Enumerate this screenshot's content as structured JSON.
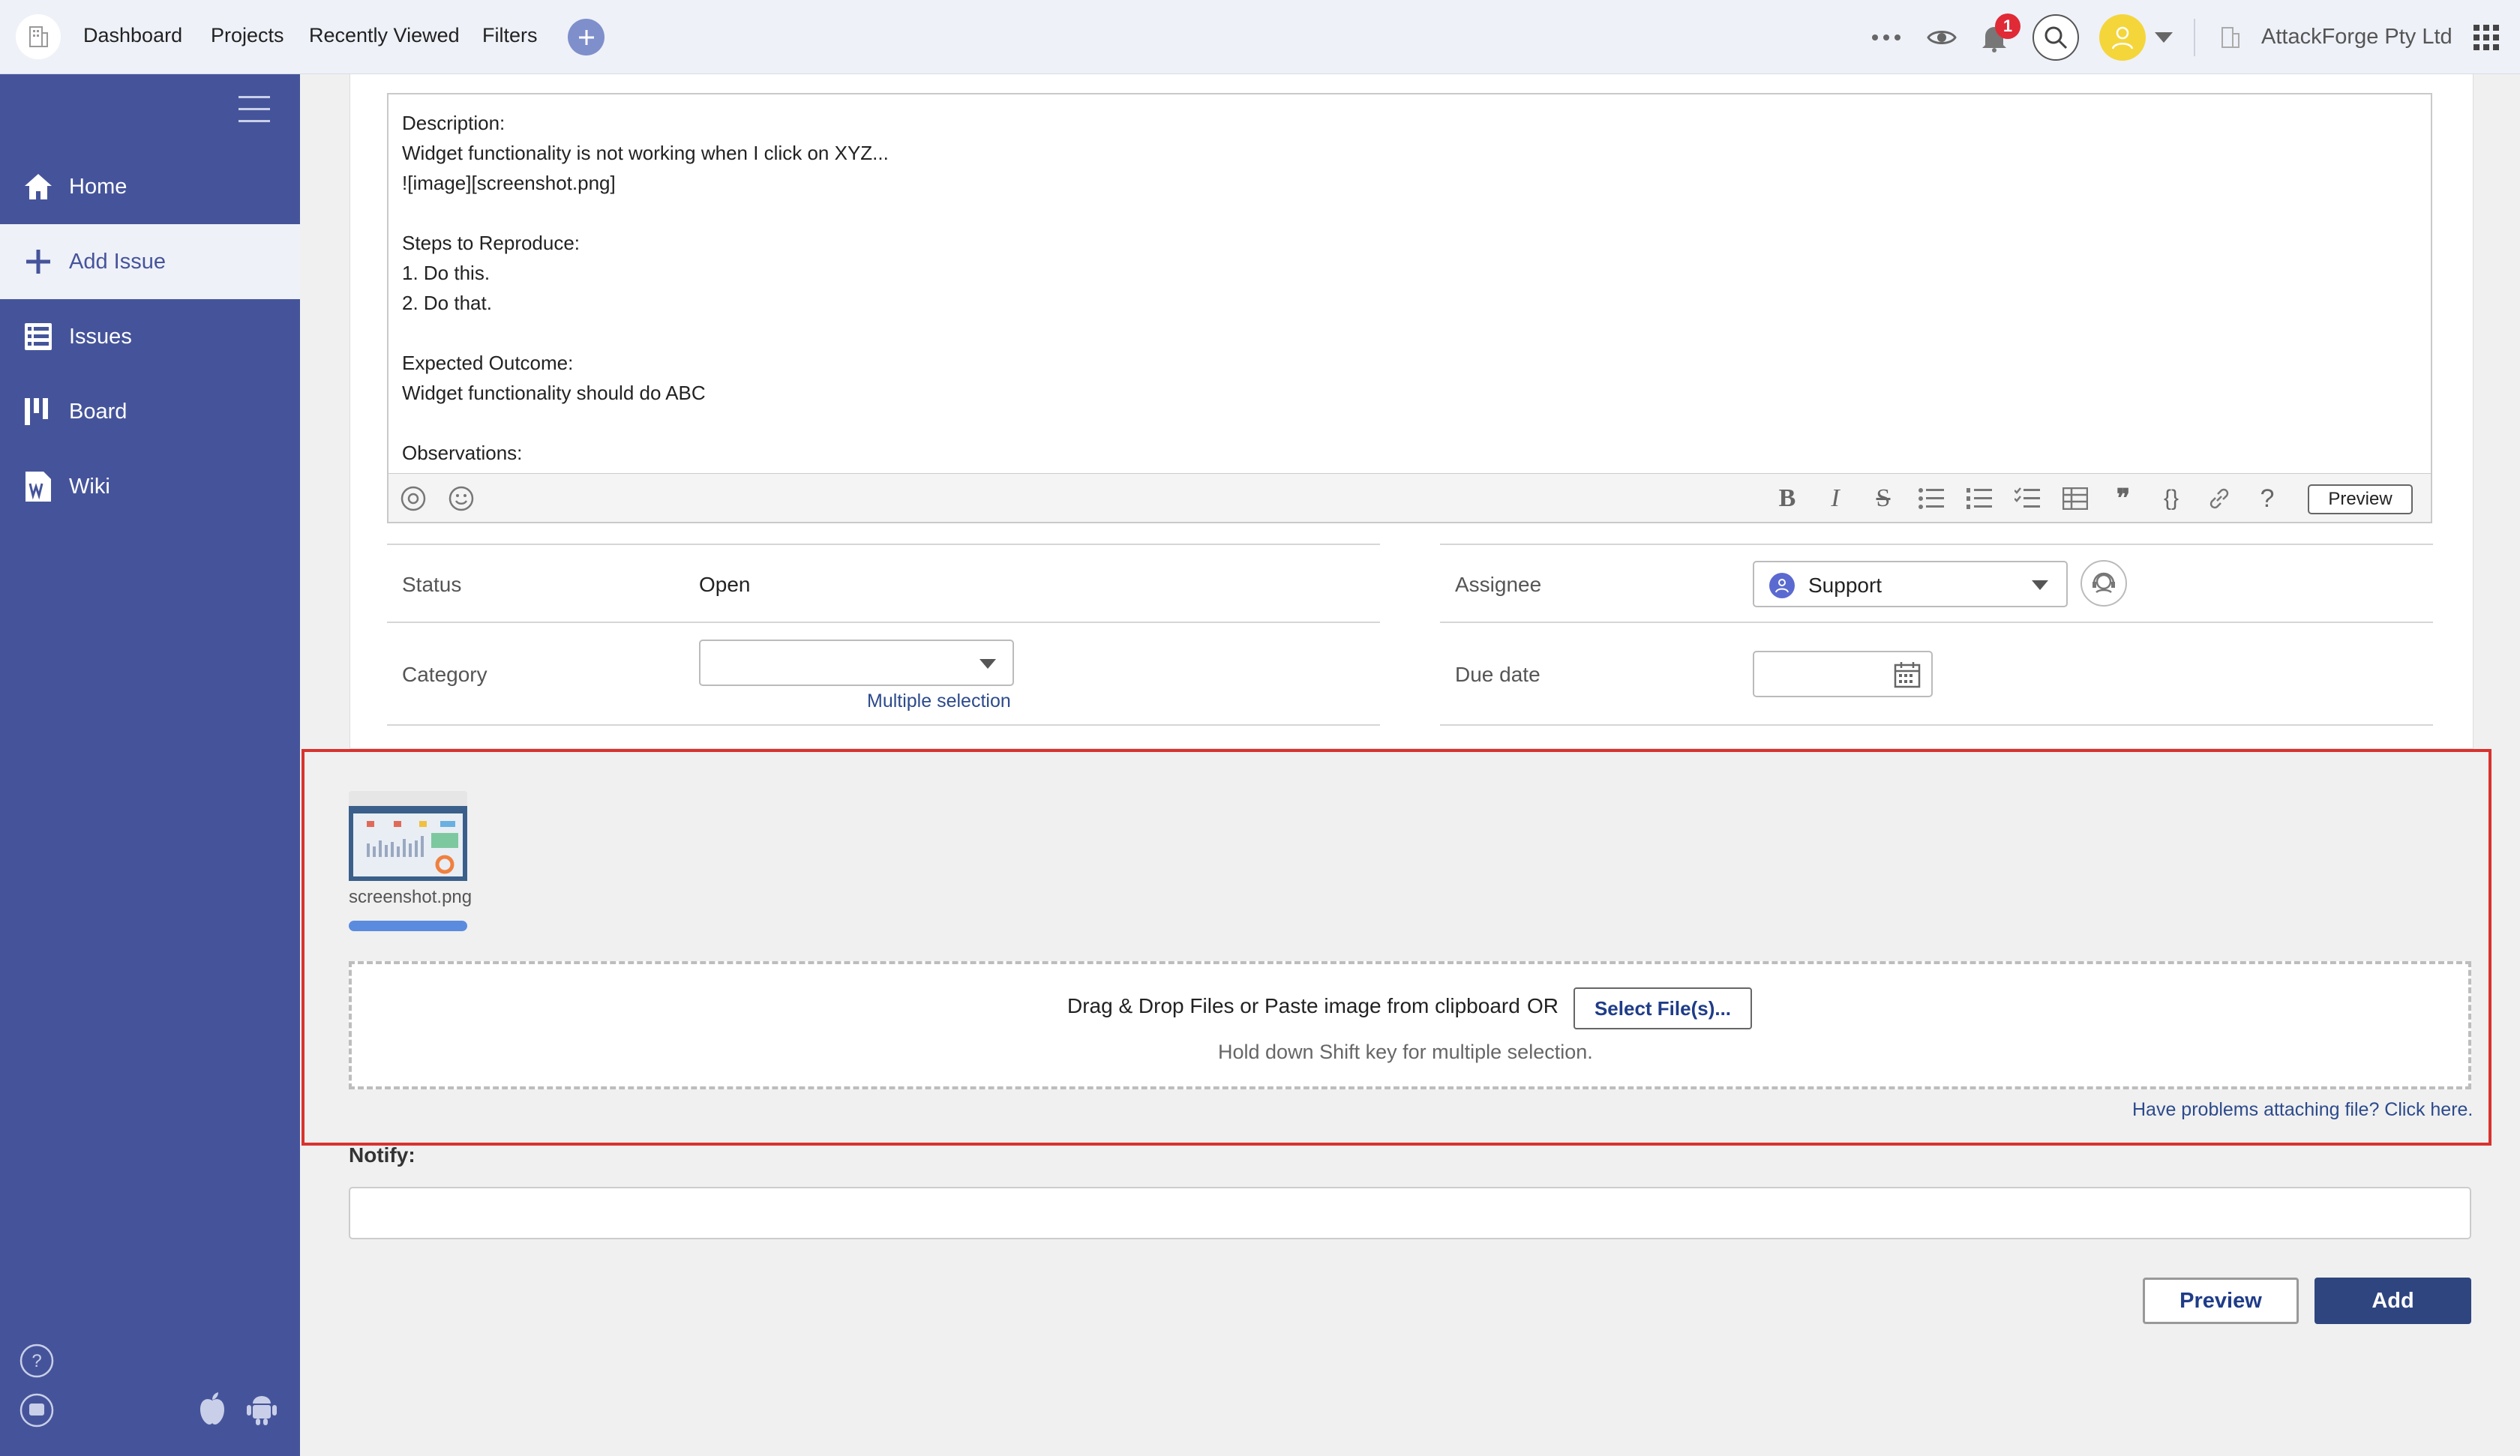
{
  "topbar": {
    "nav": [
      "Dashboard",
      "Projects",
      "Recently Viewed",
      "Filters"
    ],
    "notification_count": "1",
    "org_name": "AttackForge Pty Ltd",
    "icons": [
      "building-logo-icon",
      "plus-icon",
      "more-icon",
      "eye-icon",
      "bell-icon",
      "search-icon",
      "user-avatar-icon",
      "chevron-down-icon",
      "building-icon",
      "apps-grid-icon"
    ]
  },
  "sidebar": {
    "items": [
      {
        "label": "Home",
        "icon": "home-icon"
      },
      {
        "label": "Add Issue",
        "icon": "plus-icon",
        "active": true
      },
      {
        "label": "Issues",
        "icon": "list-icon"
      },
      {
        "label": "Board",
        "icon": "board-icon"
      },
      {
        "label": "Wiki",
        "icon": "wiki-icon"
      }
    ],
    "bottom_icons": [
      "help-icon",
      "chat-icon",
      "apple-icon",
      "android-icon"
    ]
  },
  "editor": {
    "text": "Description:\nWidget functionality is not working when I click on XYZ...\n![image][screenshot.png]\n\nSteps to Reproduce:\n1. Do this.\n2. Do that.\n\nExpected Outcome:\nWidget functionality should do ABC\n\nObservations:",
    "preview_label": "Preview",
    "toolbar_icons": [
      "mention-icon",
      "emoji-icon",
      "bold-icon",
      "italic-icon",
      "strikethrough-icon",
      "bullet-list-icon",
      "numbered-list-icon",
      "checklist-icon",
      "table-icon",
      "quote-icon",
      "code-icon",
      "link-icon",
      "help-icon"
    ]
  },
  "form": {
    "status_label": "Status",
    "status_value": "Open",
    "assignee_label": "Assignee",
    "assignee_value": "Support",
    "category_label": "Category",
    "category_link": "Multiple selection",
    "due_label": "Due date"
  },
  "attachments": {
    "file_name": "screenshot.png",
    "upload_progress": 1.0,
    "drop_text": "Drag & Drop Files or Paste image from clipboard",
    "or_text": "OR",
    "select_button": "Select File(s)...",
    "hint": "Hold down Shift key for multiple selection.",
    "problems_link": "Have problems attaching file? Click here."
  },
  "notify": {
    "label": "Notify:",
    "value": ""
  },
  "actions": {
    "preview": "Preview",
    "add": "Add"
  },
  "colors": {
    "sidebar": "#45549a",
    "primary_button": "#2f4580",
    "highlight_frame": "#d8322f",
    "badge": "#e02a36"
  }
}
